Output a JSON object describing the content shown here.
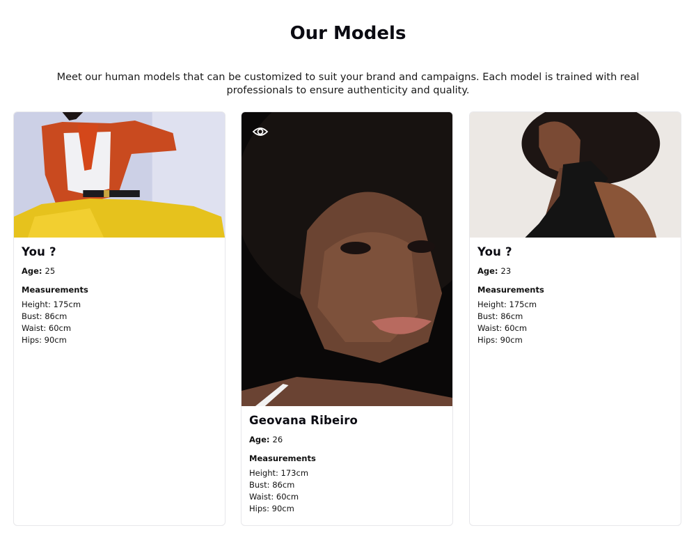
{
  "header": {
    "title": "Our Models",
    "subtitle": "Meet our human models that can be customized to suit your brand and campaigns. Each model is trained with real professionals to ensure authenticity and quality."
  },
  "labels": {
    "age": "Age:",
    "measurements": "Measurements",
    "height": "Height:",
    "bust": "Bust:",
    "waist": "Waist:",
    "hips": "Hips:"
  },
  "models": [
    {
      "name": "You ?",
      "age": "25",
      "height": "175cm",
      "bust": "86cm",
      "waist": "60cm",
      "hips": "90cm"
    },
    {
      "name": "Geovana Ribeiro",
      "age": "26",
      "height": "173cm",
      "bust": "86cm",
      "waist": "60cm",
      "hips": "90cm",
      "icon": "eye-icon"
    },
    {
      "name": "You ?",
      "age": "23",
      "height": "175cm",
      "bust": "86cm",
      "waist": "60cm",
      "hips": "90cm"
    }
  ],
  "colors": {
    "title": "#0b0b12",
    "card_border": "#e7e7ea"
  }
}
